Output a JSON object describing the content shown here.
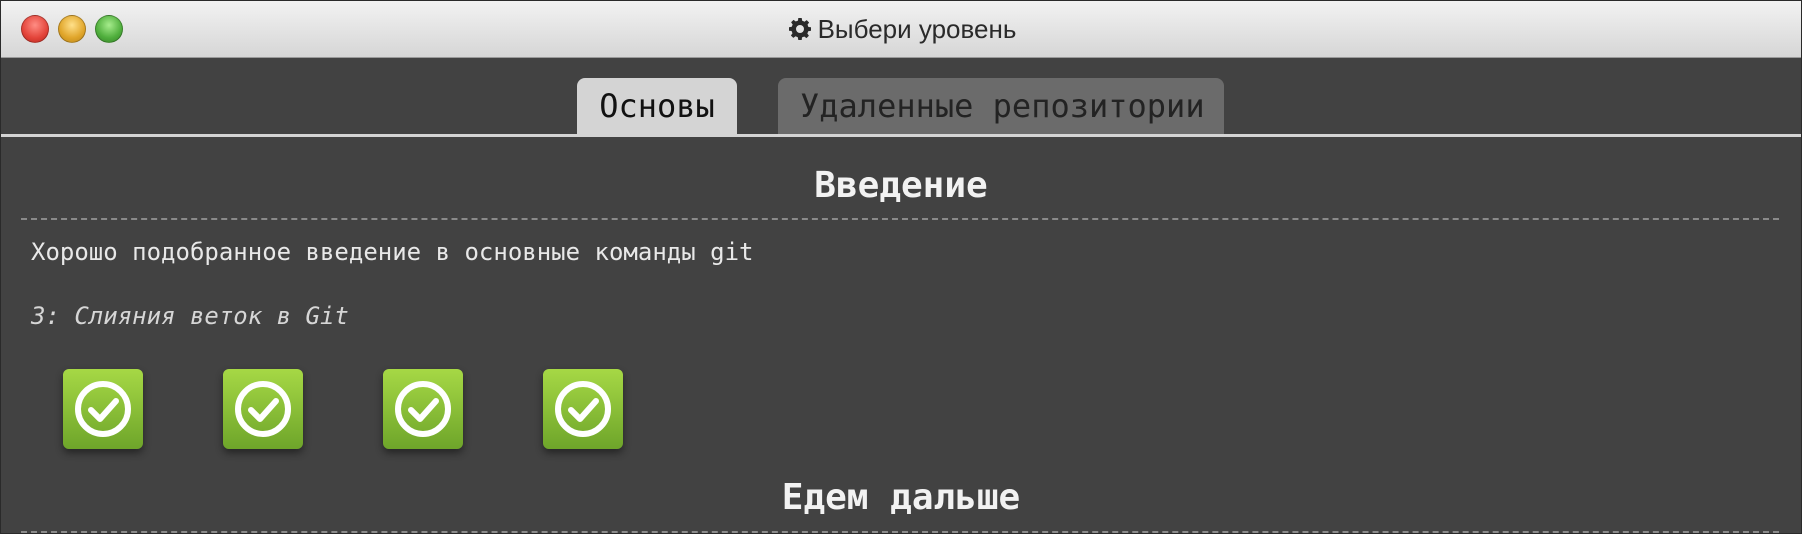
{
  "window": {
    "title": "Выбери уровень",
    "title_icon": "gear-icon"
  },
  "tabs": [
    {
      "label": "Основы",
      "active": true
    },
    {
      "label": "Удаленные репозитории",
      "active": false
    }
  ],
  "sections": [
    {
      "title": "Введение",
      "description": "Хорошо подобранное введение в основные команды git",
      "current_level": "3: Слияния веток в Git",
      "levels": [
        {
          "icon": "checkmark-icon",
          "status": "completed"
        },
        {
          "icon": "checkmark-icon",
          "status": "completed"
        },
        {
          "icon": "checkmark-icon",
          "status": "completed"
        },
        {
          "icon": "checkmark-icon",
          "status": "completed"
        }
      ]
    },
    {
      "title": "Едем дальше"
    }
  ],
  "colors": {
    "background": "#424242",
    "tab_active": "#d4d4d4",
    "tab_inactive": "#6b6b6b",
    "level_completed": "#8dc63f"
  }
}
